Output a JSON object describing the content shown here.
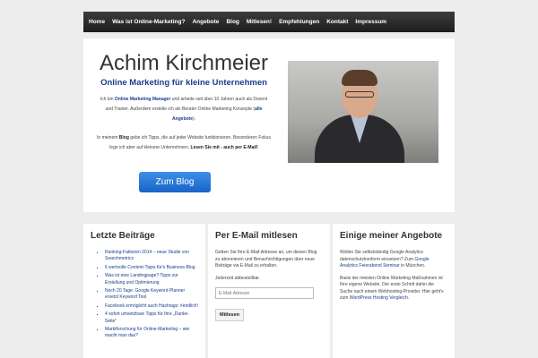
{
  "nav": [
    "Home",
    "Was ist Online-Marketing?",
    "Angebote",
    "Blog",
    "Mitlesen!",
    "Empfehlungen",
    "Kontakt",
    "Impressum"
  ],
  "hero": {
    "name": "Achim Kirchmeier",
    "tagline": "Online Marketing für kleine Unternehmen",
    "p1_a": "Ich bin ",
    "p1_link": "Online Marketing Manager",
    "p1_b": " und arbeite seit über 10 Jahren auch als Dozent und Trainer. Außerdem erstelle ich als Berater Online Marketing Konzepte (",
    "p1_link2": "alle Angebote",
    "p1_c": ").",
    "p2_a": "In meinem ",
    "p2_bold": "Blog",
    "p2_b": " gebe ich Tipps, die auf jeder Website funktionieren. Besonderen Fokus lege ich aber auf kleinere Unternehmen. ",
    "p2_bold2": "Lesen Sie mit - auch per E-Mail!",
    "button": "Zum Blog"
  },
  "posts": {
    "title": "Letzte Beiträge",
    "items": [
      "Ranking-Faktoren 2014 – neue Studie von Searchmetrics",
      "6 wertvolle Content-Tipps für's Business-Blog",
      "Was ist eine Landingpage? Tipps zur Erstellung und Optimierung",
      "Noch 20 Tage: Google Keyword Planner ersetzt Keyword Tool",
      "Facebook ermöglicht auch Hashtags: #endlich!",
      "4 sofort umsetzbare Tipps für Ihre „Danke-Seite“",
      "Marktforschung für Online-Marketing – wie macht man das?"
    ]
  },
  "subscribe": {
    "title": "Per E-Mail mitlesen",
    "text": "Geben Sie Ihre E-Mail-Adresse an, um diesen Blog zu abonnieren und Benachrichtigungen über neue Beiträge via E-Mail zu erhalten.",
    "note": "Jederzeit abbestellbar.",
    "placeholder": "E-Mail-Adresse",
    "button": "Mitlesen"
  },
  "offers": {
    "title": "Einige meiner Angebote",
    "p1_a": "Wollen Sie selbstständig Google Analytics datenschutzkonform einsetzen? Zum ",
    "p1_link": "Google Analytics Feierabend Seminar",
    "p1_b": " in München.",
    "p2_a": "Basis der meisten Online Marketing Maßnahmen ist Ihre eigene Website. Der erste Schritt dahin die Suche nach einem Webhosting-Provider. Hier geht's zum ",
    "p2_link": "WordPress Hosting Vergleich",
    "p2_b": "."
  }
}
